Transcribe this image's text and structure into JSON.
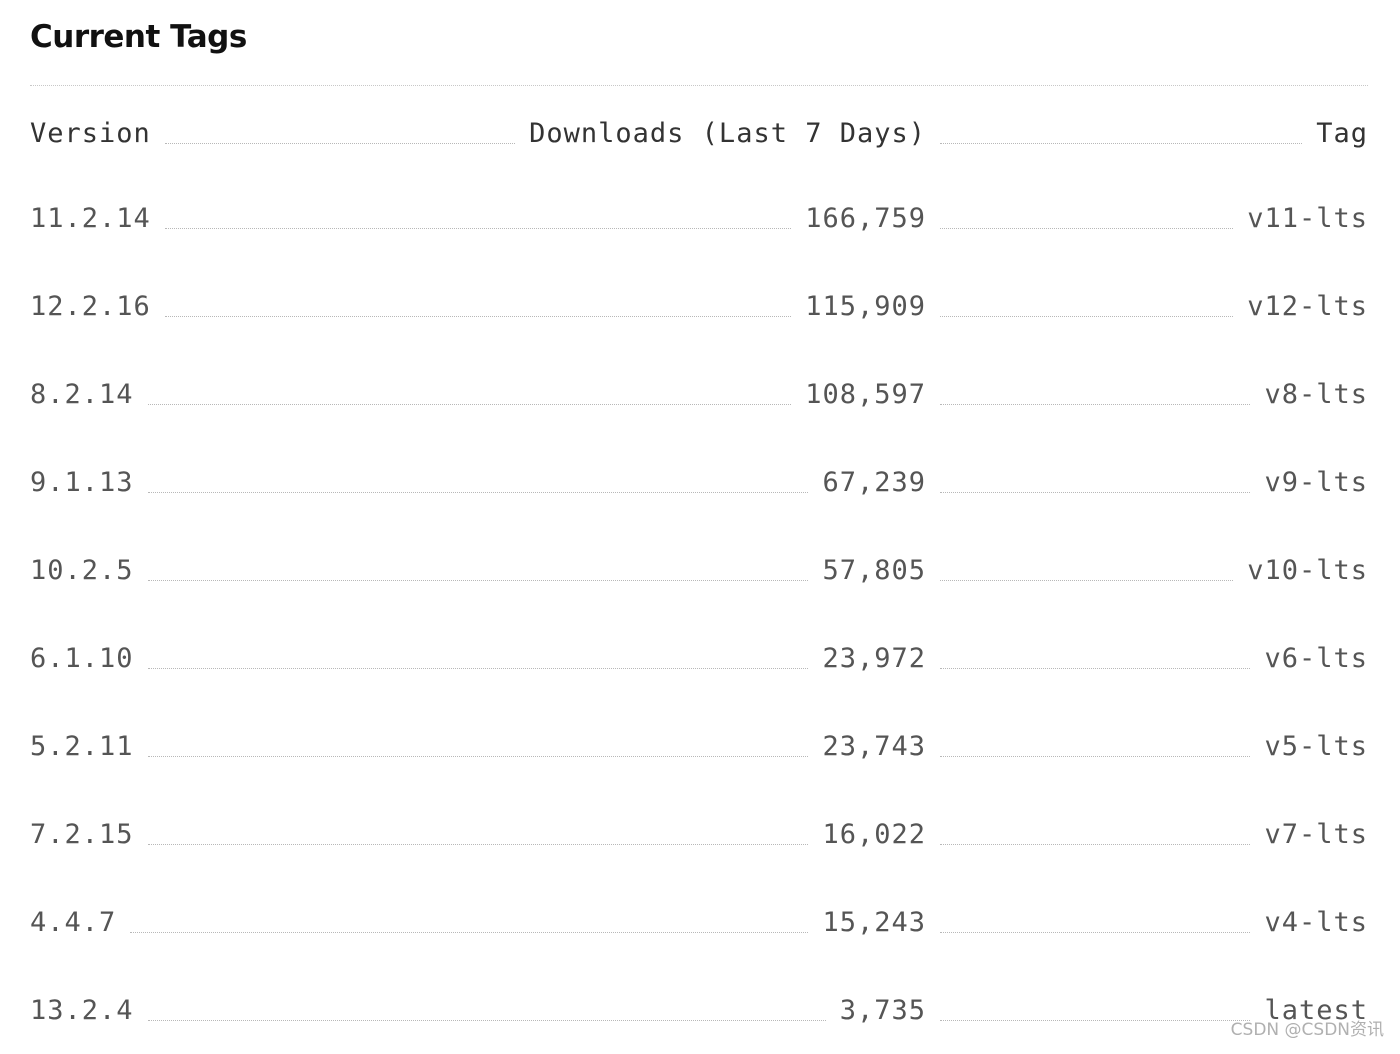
{
  "section": {
    "title": "Current Tags"
  },
  "columns": {
    "version": "Version",
    "downloads": "Downloads (Last 7 Days)",
    "tag": "Tag"
  },
  "rows": [
    {
      "version": "11.2.14",
      "downloads": "166,759",
      "tag": "v11-lts"
    },
    {
      "version": "12.2.16",
      "downloads": "115,909",
      "tag": "v12-lts"
    },
    {
      "version": "8.2.14",
      "downloads": "108,597",
      "tag": "v8-lts"
    },
    {
      "version": "9.1.13",
      "downloads": "67,239",
      "tag": "v9-lts"
    },
    {
      "version": "10.2.5",
      "downloads": "57,805",
      "tag": "v10-lts"
    },
    {
      "version": "6.1.10",
      "downloads": "23,972",
      "tag": "v6-lts"
    },
    {
      "version": "5.2.11",
      "downloads": "23,743",
      "tag": "v5-lts"
    },
    {
      "version": "7.2.15",
      "downloads": "16,022",
      "tag": "v7-lts"
    },
    {
      "version": "4.4.7",
      "downloads": "15,243",
      "tag": "v4-lts"
    },
    {
      "version": "13.2.4",
      "downloads": "3,735",
      "tag": "latest"
    }
  ],
  "watermark": "CSDN @CSDN资讯"
}
